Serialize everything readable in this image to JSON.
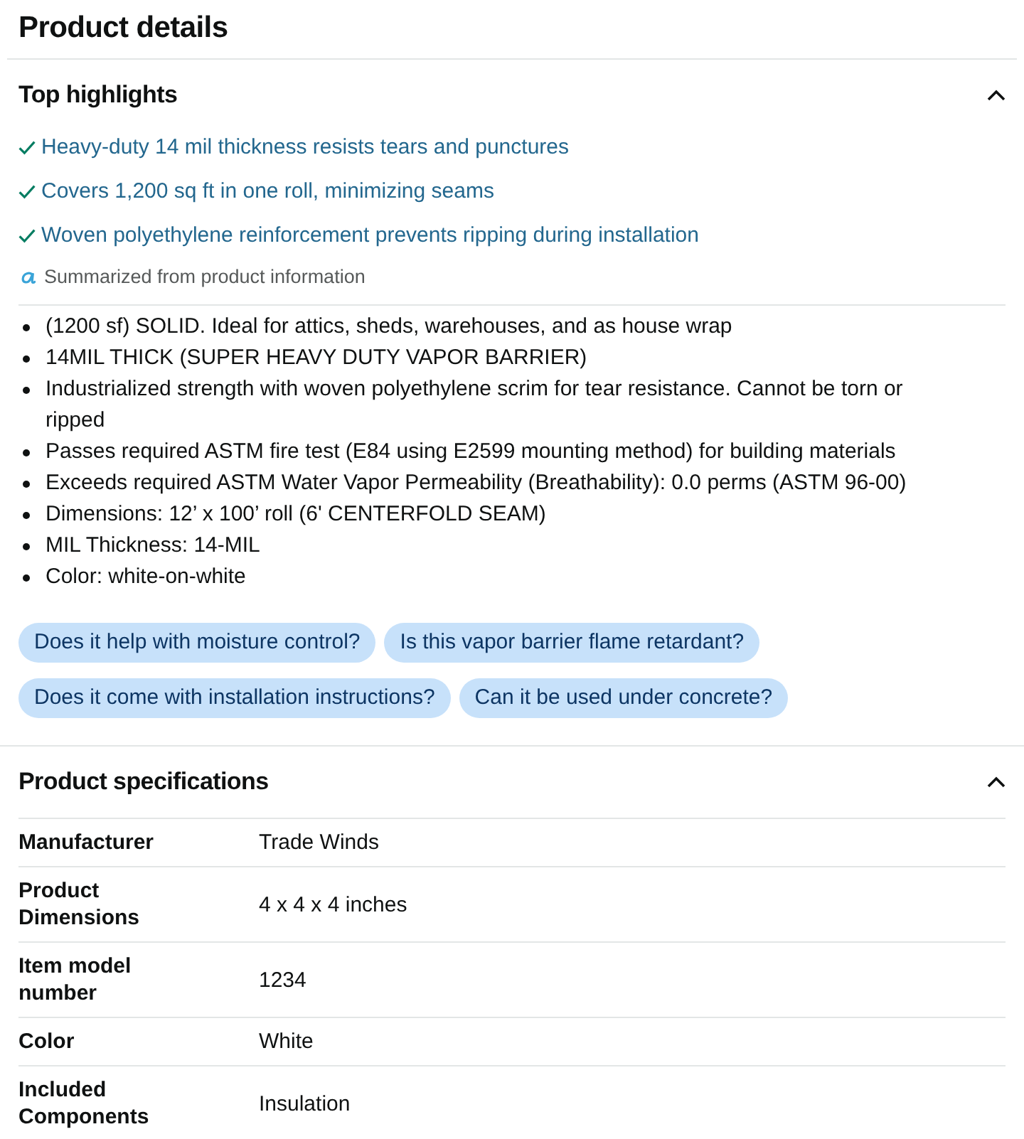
{
  "title": "Product details",
  "highlights": {
    "heading": "Top highlights",
    "expanded": true,
    "items": [
      "Heavy-duty 14 mil thickness resists tears and punctures",
      "Covers 1,200 sq ft in one roll, minimizing seams",
      "Woven polyethylene reinforcement prevents ripping during installation"
    ],
    "summary_note": "Summarized from product information",
    "bullets": [
      "(1200 sf) SOLID. Ideal for attics, sheds, warehouses, and as house wrap",
      "14MIL THICK (SUPER HEAVY DUTY VAPOR BARRIER)",
      "Industrialized strength with woven polyethylene scrim for tear resistance. Cannot be torn or ripped",
      "Passes required ASTM fire test (E84 using E2599 mounting method) for building materials",
      "Exceeds required ASTM Water Vapor Permeability (Breathability): 0.0 perms (ASTM 96-00)",
      "Dimensions: 12’ x 100’ roll (6' CENTERFOLD SEAM)",
      "MIL Thickness: 14-MIL",
      "Color: white-on-white"
    ],
    "questions": [
      "Does it help with moisture control?",
      "Is this vapor barrier flame retardant?",
      "Does it come with installation instructions?",
      "Can it be used under concrete?"
    ]
  },
  "specifications": {
    "heading": "Product specifications",
    "expanded": true,
    "rows": [
      {
        "label": "Manufacturer",
        "value": "Trade Winds"
      },
      {
        "label": "Product Dimensions",
        "value": "4 x 4 x 4 inches"
      },
      {
        "label": "Item model number",
        "value": "1234"
      },
      {
        "label": "Color",
        "value": "White"
      },
      {
        "label": "Included Components",
        "value": "Insulation"
      }
    ]
  }
}
